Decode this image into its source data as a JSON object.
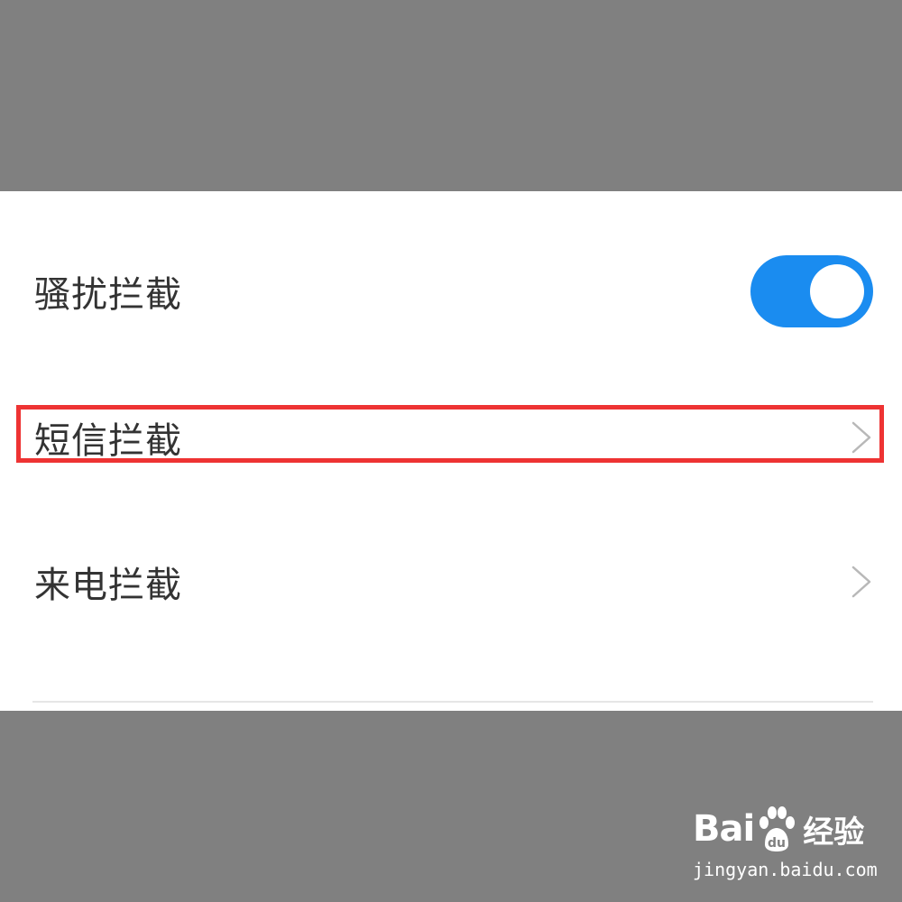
{
  "settings": {
    "rows": [
      {
        "label": "骚扰拦截",
        "control": "toggle",
        "enabled": true
      },
      {
        "label": "短信拦截",
        "control": "chevron",
        "highlighted": true
      },
      {
        "label": "来电拦截",
        "control": "chevron"
      }
    ]
  },
  "colors": {
    "toggle_on": "#1a8cf0",
    "highlight": "#ee3333",
    "backdrop": "#808080",
    "panel": "#ffffff",
    "text": "#333333"
  },
  "watermark": {
    "brand_prefix": "Bai",
    "brand_suffix": "经验",
    "url": "jingyan.baidu.com",
    "icon": "baidu-paw-icon"
  }
}
